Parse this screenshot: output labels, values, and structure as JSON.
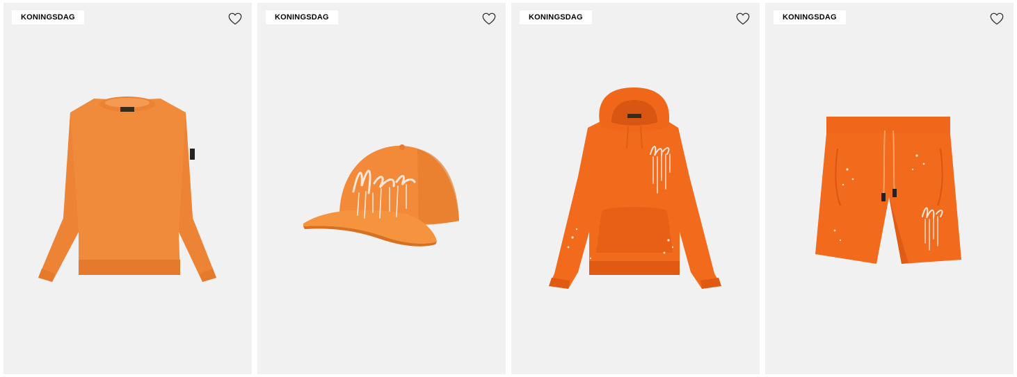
{
  "colors": {
    "card_bg": "#f1f1f1",
    "badge_bg": "#ffffff",
    "orange_light": "#f18b3c",
    "orange_bright": "#f26a1c",
    "logo_white": "#fbe7d9"
  },
  "products": [
    {
      "badge": "KONINGSDAG",
      "favorite_icon": "heart-outline-icon",
      "image": "orange-crewneck-sweater"
    },
    {
      "badge": "KONINGSDAG",
      "favorite_icon": "heart-outline-icon",
      "image": "orange-baseball-cap"
    },
    {
      "badge": "KONINGSDAG",
      "favorite_icon": "heart-outline-icon",
      "image": "orange-hoodie"
    },
    {
      "badge": "KONINGSDAG",
      "favorite_icon": "heart-outline-icon",
      "image": "orange-shorts"
    }
  ]
}
